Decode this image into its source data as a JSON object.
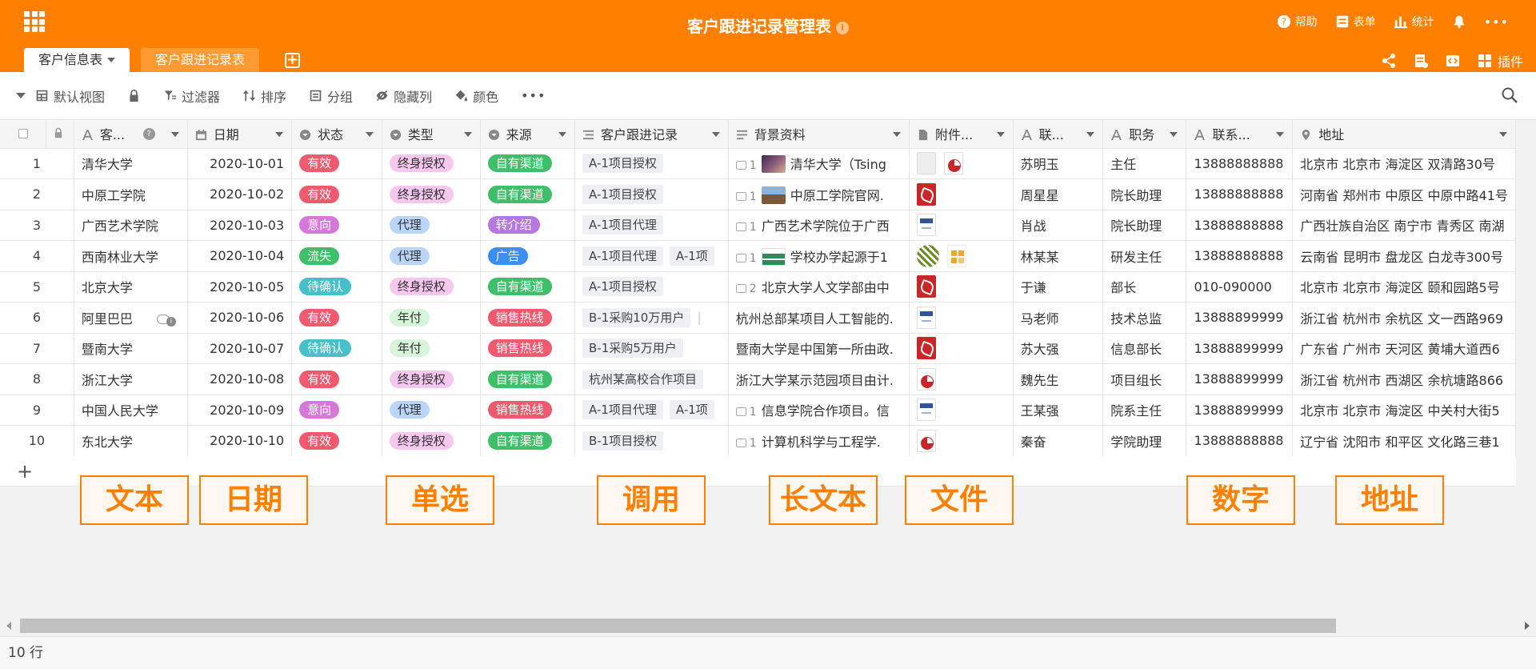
{
  "app": {
    "title": "客户跟进记录管理表",
    "info_glyph": "i"
  },
  "top_actions": [
    {
      "icon": "help-icon",
      "label": "帮助"
    },
    {
      "icon": "form-icon",
      "label": "表单"
    },
    {
      "icon": "stats-icon",
      "label": "统计"
    },
    {
      "icon": "bell-icon",
      "label": ""
    },
    {
      "icon": "more-icon",
      "label": "•••"
    }
  ],
  "tabs": {
    "active": "客户信息表",
    "inactive": "客户跟进记录表",
    "add": "+"
  },
  "tab_right": {
    "plugin_label": "插件"
  },
  "toolbar": {
    "view": "默认视图",
    "filter": "过滤器",
    "sort": "排序",
    "group": "分组",
    "hide": "隐藏列",
    "color": "颜色",
    "more": "•••"
  },
  "columns": [
    "客...",
    "日期",
    "状态",
    "类型",
    "来源",
    "客户跟进记录",
    "背景资料",
    "附件...",
    "联...",
    "职务",
    "联系...",
    "地址"
  ],
  "colors": {
    "brand": "#ff8000",
    "status": {
      "有效": "#ef5a6f",
      "意向": "#d578d9",
      "流失": "#3fbf6a",
      "待确认": "#46c1c9"
    },
    "type": {
      "终身授权": "#f7c8ef",
      "代理": "#b9d5f7",
      "年付": "#d7f5d9"
    },
    "source": {
      "自有渠道": "#3fbf6a",
      "转介绍": "#b577e0",
      "广告": "#3b8ff0",
      "销售热线": "#ef5a6f"
    }
  },
  "rows": [
    {
      "no": "1",
      "name": "清华大学",
      "date": "2020-10-01",
      "status": "有效",
      "type": "终身授权",
      "source": "自有渠道",
      "records": [
        "A-1项目授权"
      ],
      "bg_count": "1",
      "bg_thumb": "photo",
      "bg_text": "清华大学（Tsing",
      "files": [
        "blank",
        "ppt"
      ],
      "contact": "苏明玉",
      "role": "主任",
      "phone": "13888888888",
      "addr": "北京市 北京市 海淀区 双清路30号"
    },
    {
      "no": "2",
      "name": "中原工学院",
      "date": "2020-10-02",
      "status": "有效",
      "type": "终身授权",
      "source": "自有渠道",
      "records": [
        "A-1项目授权"
      ],
      "bg_count": "1",
      "bg_thumb": "building",
      "bg_text": "中原工学院官网.",
      "files": [
        "pdf"
      ],
      "contact": "周星星",
      "role": "院长助理",
      "phone": "13888888888",
      "addr": "河南省 郑州市 中原区 中原中路41号"
    },
    {
      "no": "3",
      "name": "广西艺术学院",
      "date": "2020-10-03",
      "status": "意向",
      "type": "代理",
      "source": "转介绍",
      "records": [
        "A-1项目代理"
      ],
      "bg_count": "1",
      "bg_thumb": "",
      "bg_text": "广西艺术学院位于广西",
      "files": [
        "doc"
      ],
      "contact": "肖战",
      "role": "院长助理",
      "phone": "13888888888",
      "addr": "广西壮族自治区 南宁市 青秀区 南湖"
    },
    {
      "no": "4",
      "name": "西南林业大学",
      "date": "2020-10-04",
      "status": "流失",
      "type": "代理",
      "source": "广告",
      "records": [
        "A-1项目代理",
        "A-1项"
      ],
      "bg_count": "1",
      "bg_thumb": "banner",
      "bg_text": "学校办学起源于1",
      "files": [
        "qr",
        "grid"
      ],
      "contact": "林某某",
      "role": "研发主任",
      "phone": "13888888888",
      "addr": "云南省 昆明市 盘龙区 白龙寺300号"
    },
    {
      "no": "5",
      "name": "北京大学",
      "date": "2020-10-05",
      "status": "待确认",
      "type": "终身授权",
      "source": "自有渠道",
      "records": [
        "A-1项目授权"
      ],
      "bg_count": "2",
      "bg_thumb": "",
      "bg_text": "北京大学人文学部由中",
      "files": [
        "pdf"
      ],
      "contact": "于谦",
      "role": "部长",
      "phone": "010-090000",
      "addr": "北京市 北京市 海淀区 颐和园路5号"
    },
    {
      "no": "6",
      "name": "阿里巴巴",
      "date": "2020-10-06",
      "status": "有效",
      "type": "年付",
      "source": "销售热线",
      "records": [
        "B-1采购10万用户",
        "|"
      ],
      "bg_count": "",
      "bg_thumb": "",
      "bg_text": "杭州总部某项目人工智能的.",
      "files": [
        "doc"
      ],
      "contact": "马老师",
      "role": "技术总监",
      "phone": "13888899999",
      "addr": "浙江省 杭州市 余杭区 文一西路969"
    },
    {
      "no": "7",
      "name": "暨南大学",
      "date": "2020-10-07",
      "status": "待确认",
      "type": "年付",
      "source": "销售热线",
      "records": [
        "B-1采购5万用户"
      ],
      "bg_count": "",
      "bg_thumb": "",
      "bg_text": "暨南大学是中国第一所由政.",
      "files": [
        "pdf"
      ],
      "contact": "苏大强",
      "role": "信息部长",
      "phone": "13888899999",
      "addr": "广东省 广州市 天河区 黄埔大道西6"
    },
    {
      "no": "8",
      "name": "浙江大学",
      "date": "2020-10-08",
      "status": "有效",
      "type": "终身授权",
      "source": "自有渠道",
      "records": [
        "杭州某高校合作项目"
      ],
      "bg_count": "",
      "bg_thumb": "",
      "bg_text": "浙江大学某示范园项目由计.",
      "files": [
        "ppt"
      ],
      "contact": "魏先生",
      "role": "项目组长",
      "phone": "13888899999",
      "addr": "浙江省 杭州市 西湖区 余杭塘路866"
    },
    {
      "no": "9",
      "name": "中国人民大学",
      "date": "2020-10-09",
      "status": "意向",
      "type": "代理",
      "source": "销售热线",
      "records": [
        "A-1项目代理",
        "A-1项"
      ],
      "bg_count": "1",
      "bg_thumb": "",
      "bg_text": "信息学院合作项目。信",
      "files": [
        "doc"
      ],
      "contact": "王某强",
      "role": "院系主任",
      "phone": "13888899999",
      "addr": "北京市 北京市 海淀区 中关村大街5"
    },
    {
      "no": "10",
      "name": "东北大学",
      "date": "2020-10-10",
      "status": "有效",
      "type": "终身授权",
      "source": "自有渠道",
      "records": [
        "B-1项目授权"
      ],
      "bg_count": "1",
      "bg_thumb": "",
      "bg_text": "计算机科学与工程学.",
      "files": [
        "ppt"
      ],
      "contact": "秦奋",
      "role": "学院助理",
      "phone": "13888888888",
      "addr": "辽宁省 沈阳市 和平区 文化路三巷1"
    }
  ],
  "add_row": "+",
  "annotations": [
    "文本",
    "日期",
    "单选",
    "调用",
    "长文本",
    "文件",
    "数字",
    "地址"
  ],
  "footer": {
    "row_count": "10 行"
  }
}
